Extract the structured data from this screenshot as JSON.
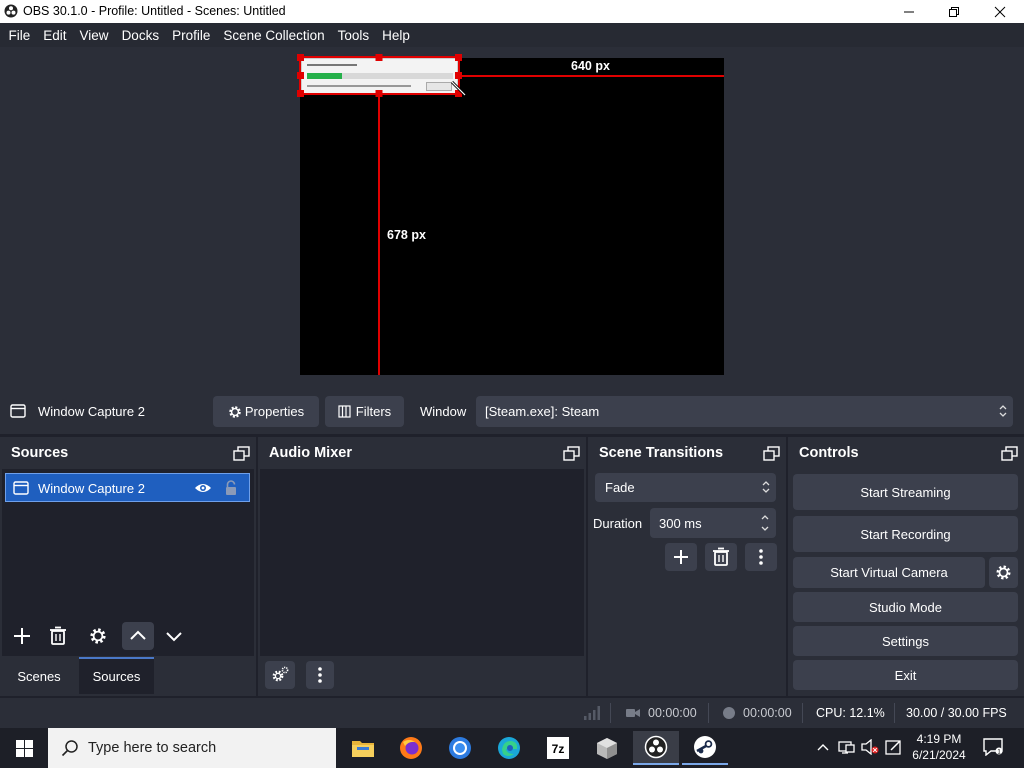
{
  "window": {
    "title": "OBS 30.1.0 - Profile: Untitled - Scenes: Untitled"
  },
  "menu": [
    "File",
    "Edit",
    "View",
    "Docks",
    "Profile",
    "Scene Collection",
    "Tools",
    "Help"
  ],
  "preview": {
    "width_label": "640 px",
    "height_label": "678 px"
  },
  "source_toolbar": {
    "source_name": "Window Capture 2",
    "properties_label": "Properties",
    "filters_label": "Filters",
    "window_label": "Window",
    "window_value": "[Steam.exe]: Steam"
  },
  "sources": {
    "title": "Sources",
    "items": [
      {
        "label": "Window Capture 2"
      }
    ],
    "tabs": [
      "Scenes",
      "Sources"
    ]
  },
  "audio_mixer": {
    "title": "Audio Mixer"
  },
  "transitions": {
    "title": "Scene Transitions",
    "selected": "Fade",
    "duration_label": "Duration",
    "duration_value": "300 ms"
  },
  "controls": {
    "title": "Controls",
    "start_streaming": "Start Streaming",
    "start_recording": "Start Recording",
    "start_virtual_camera": "Start Virtual Camera",
    "studio_mode": "Studio Mode",
    "settings": "Settings",
    "exit": "Exit"
  },
  "status": {
    "stream_time": "00:00:00",
    "record_time": "00:00:00",
    "cpu": "CPU: 12.1%",
    "fps": "30.00 / 30.00 FPS"
  },
  "taskbar": {
    "search_placeholder": "Type here to search",
    "time": "4:19 PM",
    "date": "6/21/2024"
  },
  "colors": {
    "accent_blue": "#1f5fbf",
    "selection": "#e00000"
  }
}
